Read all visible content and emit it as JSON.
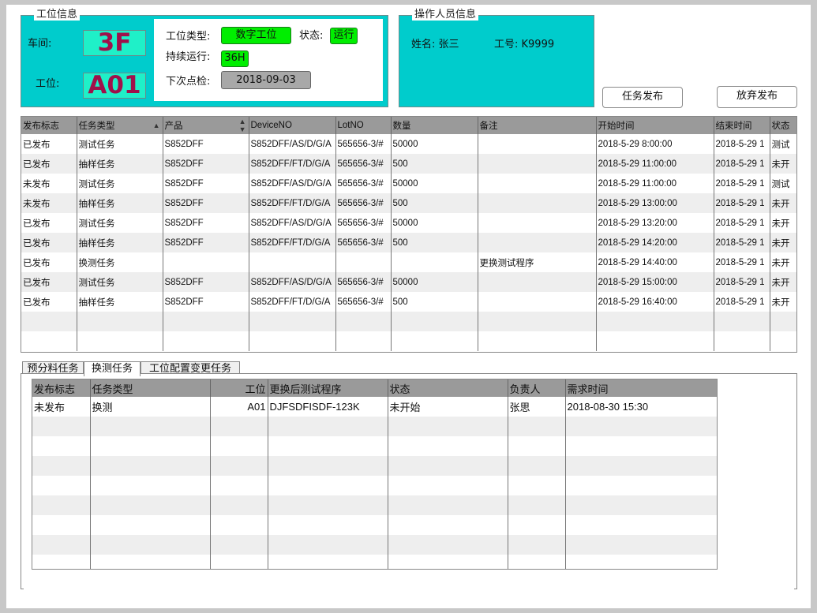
{
  "station_info": {
    "title": "工位信息",
    "workshop_label": "车间:",
    "workshop_value": "3F",
    "station_label": "工位:",
    "station_value": "A01",
    "type_label": "工位类型:",
    "type_value": "数字工位",
    "status_label": "状态:",
    "status_value": "运行",
    "running_label": "持续运行:",
    "running_value": "36H",
    "next_check_label": "下次点检:",
    "next_check_value": "2018-09-03"
  },
  "operator_info": {
    "title": "操作人员信息",
    "name_text": "姓名: 张三",
    "id_text": "工号: K9999"
  },
  "buttons": {
    "publish": "任务发布",
    "abandon": "放弃发布"
  },
  "task_table": {
    "columns": [
      "发布标志",
      "任务类型",
      "产品",
      "DeviceNO",
      "LotNO",
      "数量",
      "备注",
      "开始时间",
      "结束时间",
      "状态"
    ],
    "rows": [
      [
        "已发布",
        "测试任务",
        "S852DFF",
        "S852DFF/AS/D/G/A",
        "565656-3/#",
        "50000",
        "",
        "2018-5-29  8:00:00",
        "2018-5-29 1",
        "测试"
      ],
      [
        "已发布",
        "抽样任务",
        "S852DFF",
        "S852DFF/FT/D/G/A",
        "565656-3/#",
        "500",
        "",
        "2018-5-29  11:00:00",
        "2018-5-29 1",
        "未开"
      ],
      [
        "未发布",
        "测试任务",
        "S852DFF",
        "S852DFF/AS/D/G/A",
        "565656-3/#",
        "50000",
        "",
        "2018-5-29  11:00:00",
        "2018-5-29 1",
        "测试"
      ],
      [
        "未发布",
        "抽样任务",
        "S852DFF",
        "S852DFF/FT/D/G/A",
        "565656-3/#",
        "500",
        "",
        "2018-5-29  13:00:00",
        "2018-5-29 1",
        "未开"
      ],
      [
        "已发布",
        "测试任务",
        "S852DFF",
        "S852DFF/AS/D/G/A",
        "565656-3/#",
        "50000",
        "",
        "2018-5-29  13:20:00",
        "2018-5-29 1",
        "未开"
      ],
      [
        "已发布",
        "抽样任务",
        "S852DFF",
        "S852DFF/FT/D/G/A",
        "565656-3/#",
        "500",
        "",
        "2018-5-29  14:20:00",
        "2018-5-29 1",
        "未开"
      ],
      [
        "已发布",
        "换测任务",
        "",
        "",
        "",
        "",
        "更换测试程序",
        "2018-5-29  14:40:00",
        "2018-5-29 1",
        "未开"
      ],
      [
        "已发布",
        "测试任务",
        "S852DFF",
        "S852DFF/AS/D/G/A",
        "565656-3/#",
        "50000",
        "",
        "2018-5-29  15:00:00",
        "2018-5-29 1",
        "未开"
      ],
      [
        "已发布",
        "抽样任务",
        "S852DFF",
        "S852DFF/FT/D/G/A",
        "565656-3/#",
        "500",
        "",
        "2018-5-29  16:40:00",
        "2018-5-29 1",
        "未开"
      ]
    ]
  },
  "tabs": [
    {
      "label": "预分料任务",
      "active": false
    },
    {
      "label": "换测任务",
      "active": true
    },
    {
      "label": "工位配置变更任务",
      "active": false
    }
  ],
  "change_table": {
    "columns": [
      "发布标志",
      "任务类型",
      "工位",
      "更换后测试程序",
      "状态",
      "负责人",
      "需求时间"
    ],
    "rows": [
      [
        "未发布",
        "换测",
        "A01",
        "DJFSDFISDF-123K",
        "未开始",
        "张思",
        "2018-08-30 15:30"
      ]
    ]
  }
}
